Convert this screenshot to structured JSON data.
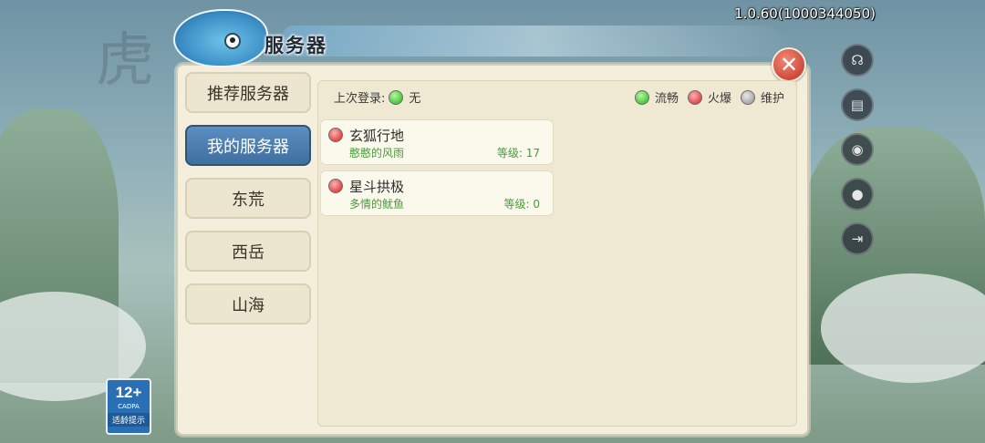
{
  "version": "1.0.60(1000344050)",
  "panel": {
    "title": "服务器"
  },
  "tabs": [
    {
      "label": "推荐服务器",
      "active": false
    },
    {
      "label": "我的服务器",
      "active": true
    },
    {
      "label": "东荒",
      "active": false
    },
    {
      "label": "西岳",
      "active": false
    },
    {
      "label": "山海",
      "active": false
    }
  ],
  "last_login": {
    "label": "上次登录:",
    "value": "无",
    "status": "green"
  },
  "legend": [
    {
      "label": "流畅",
      "color": "green"
    },
    {
      "label": "火爆",
      "color": "red"
    },
    {
      "label": "维护",
      "color": "gray"
    }
  ],
  "servers": [
    {
      "name": "玄狐行地",
      "status": "red",
      "character": "憨憨的风雨",
      "level": "等级: 17"
    },
    {
      "name": "星斗拱极",
      "status": "red",
      "character": "多情的鱿鱼",
      "level": "等级: 0"
    }
  ],
  "age_badge": {
    "age": "12+",
    "org": "CADPA",
    "tip": "适龄提示"
  },
  "colors": {
    "status_green": "#4bc83a",
    "status_red": "#e34848",
    "status_gray": "#a9a9a9",
    "tab_active": "#4a7fb0"
  }
}
